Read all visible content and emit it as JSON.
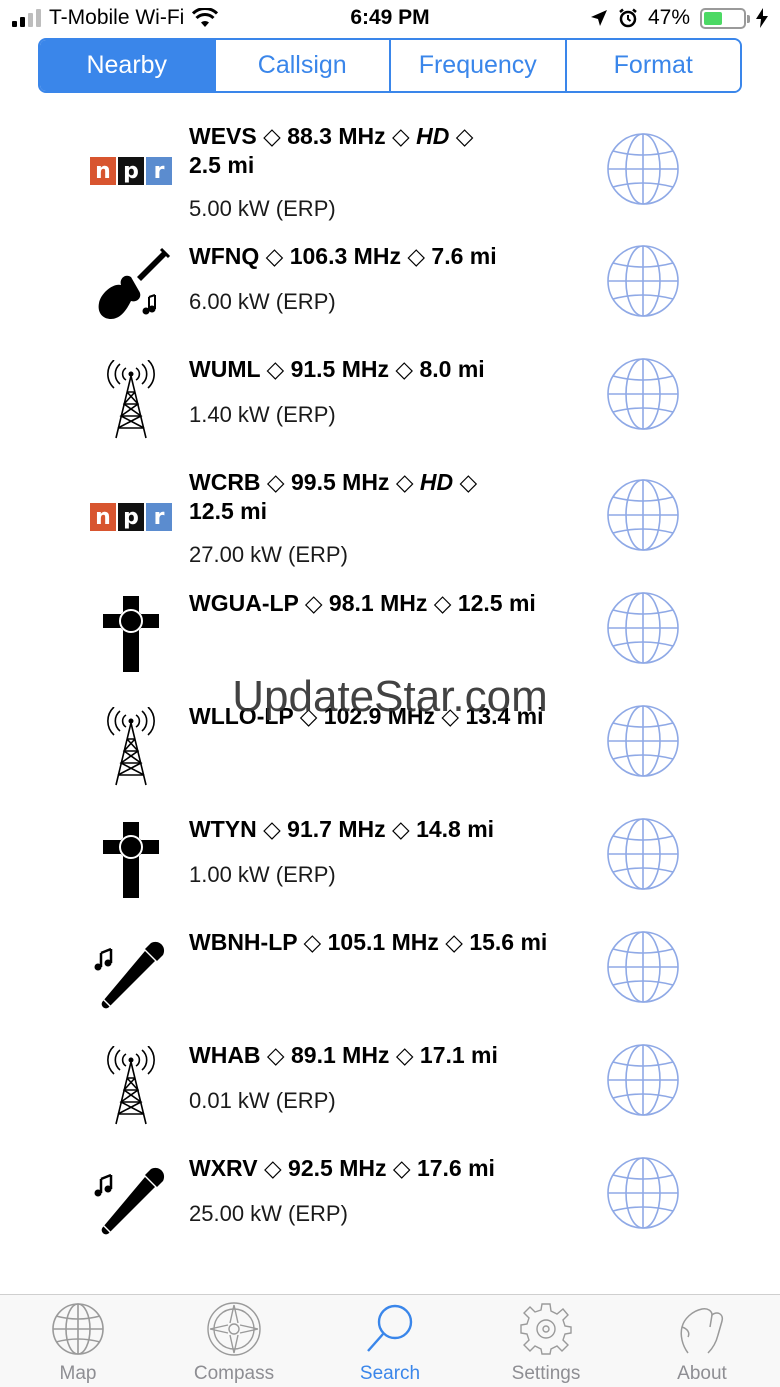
{
  "status": {
    "carrier": "T-Mobile Wi-Fi",
    "time": "6:49 PM",
    "battery": "47%",
    "battery_level": 0.47
  },
  "segments": [
    {
      "label": "Nearby",
      "active": true
    },
    {
      "label": "Callsign",
      "active": false
    },
    {
      "label": "Frequency",
      "active": false
    },
    {
      "label": "Format",
      "active": false
    }
  ],
  "stations": [
    {
      "icon": "npr-logo",
      "title_pre": "WEVS ◇ 88.3 MHz ◇ ",
      "hd": "HD",
      "title_post": " ◇",
      "title_line2": "2.5 mi",
      "power": "5.00 kW (ERP)"
    },
    {
      "icon": "guitar-icon",
      "title": "WFNQ ◇ 106.3 MHz ◇ 7.6 mi",
      "power": "6.00 kW (ERP)"
    },
    {
      "icon": "radio-tower-icon",
      "title": "WUML ◇ 91.5 MHz ◇ 8.0 mi",
      "power": "1.40 kW (ERP)"
    },
    {
      "icon": "npr-logo",
      "title_pre": "WCRB ◇ 99.5 MHz ◇ ",
      "hd": "HD",
      "title_post": " ◇",
      "title_line2": "12.5 mi",
      "power": "27.00 kW (ERP)"
    },
    {
      "icon": "cross-icon",
      "title": "WGUA-LP ◇ 98.1 MHz ◇ 12.5 mi",
      "power": ""
    },
    {
      "icon": "radio-tower-icon",
      "title": "WLLO-LP ◇ 102.9 MHz ◇ 13.4 mi",
      "power": ""
    },
    {
      "icon": "cross-icon",
      "title": "WTYN ◇ 91.7 MHz ◇ 14.8 mi",
      "power": "1.00 kW (ERP)"
    },
    {
      "icon": "microphone-icon",
      "title": "WBNH-LP ◇ 105.1 MHz ◇ 15.6 mi",
      "power": ""
    },
    {
      "icon": "radio-tower-icon",
      "title": "WHAB ◇ 89.1 MHz ◇ 17.1 mi",
      "power": "0.01 kW (ERP)"
    },
    {
      "icon": "microphone-icon",
      "title": "WXRV ◇ 92.5 MHz ◇ 17.6 mi",
      "power": "25.00 kW (ERP)"
    }
  ],
  "watermark": "UpdateStar.com",
  "tabs": [
    {
      "label": "Map",
      "icon": "globe-icon",
      "active": false
    },
    {
      "label": "Compass",
      "icon": "compass-icon",
      "active": false
    },
    {
      "label": "Search",
      "icon": "search-icon",
      "active": true
    },
    {
      "label": "Settings",
      "icon": "gear-icon",
      "active": false
    },
    {
      "label": "About",
      "icon": "hand-icon",
      "active": false
    }
  ],
  "colors": {
    "accent": "#3a86ea",
    "inactive": "#8e8e93",
    "globe": "#8fa9e6"
  }
}
